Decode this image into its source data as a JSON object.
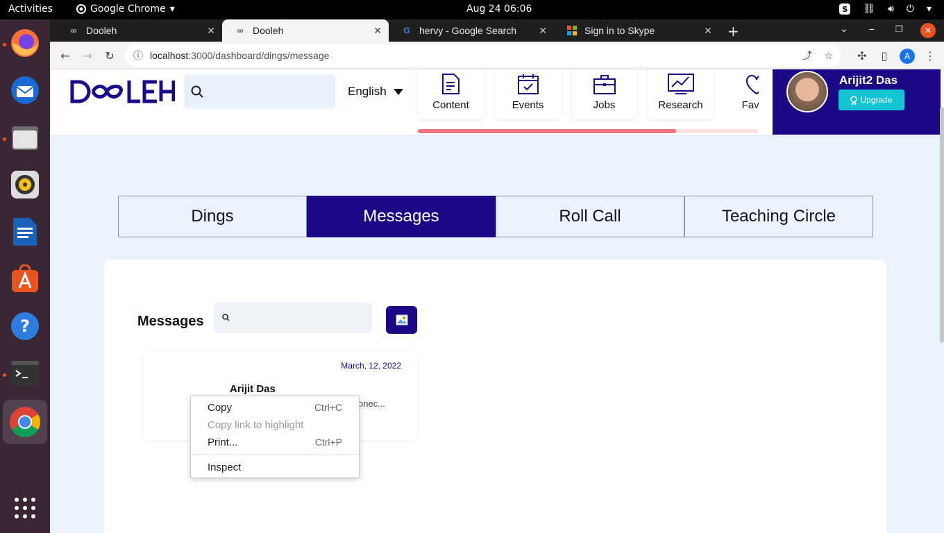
{
  "system": {
    "activities": "Activities",
    "app_name": "Google Chrome",
    "clock": "Aug 24  06:06"
  },
  "browser": {
    "tabs": [
      {
        "title": "Dooleh"
      },
      {
        "title": "Dooleh"
      },
      {
        "title": "hervy - Google Search"
      },
      {
        "title": "Sign in to Skype"
      }
    ],
    "url_host": "localhost",
    "url_path": ":3000/dashboard/dings/message",
    "profile_initial": "A"
  },
  "header": {
    "logo": "DOOLEH",
    "language": "English",
    "nav": [
      {
        "label": "Content"
      },
      {
        "label": "Events"
      },
      {
        "label": "Jobs"
      },
      {
        "label": "Research"
      },
      {
        "label": "Favou"
      }
    ],
    "nav_scroll_fraction": 0.76,
    "user_name": "Arijit2 Das",
    "upgrade_label": "Upgrade"
  },
  "page_tabs": [
    {
      "label": "Dings"
    },
    {
      "label": "Messages"
    },
    {
      "label": "Roll Call"
    },
    {
      "label": "Teaching Circle"
    }
  ],
  "messages": {
    "title": "Messages",
    "items": [
      {
        "date": "March, 12, 2022",
        "name": "Arijit Das",
        "preview": "onec..."
      }
    ]
  },
  "context_menu": {
    "items": [
      {
        "label": "Copy",
        "shortcut": "Ctrl+C"
      },
      {
        "label": "Copy link to highlight",
        "shortcut": ""
      },
      {
        "label": "Print...",
        "shortcut": "Ctrl+P"
      },
      {
        "label": "Inspect",
        "shortcut": ""
      }
    ]
  },
  "colors": {
    "brand": "#1c0786",
    "accent": "#13c4d4",
    "page_bg": "#eaf3fd",
    "progress": "#f5727f"
  }
}
